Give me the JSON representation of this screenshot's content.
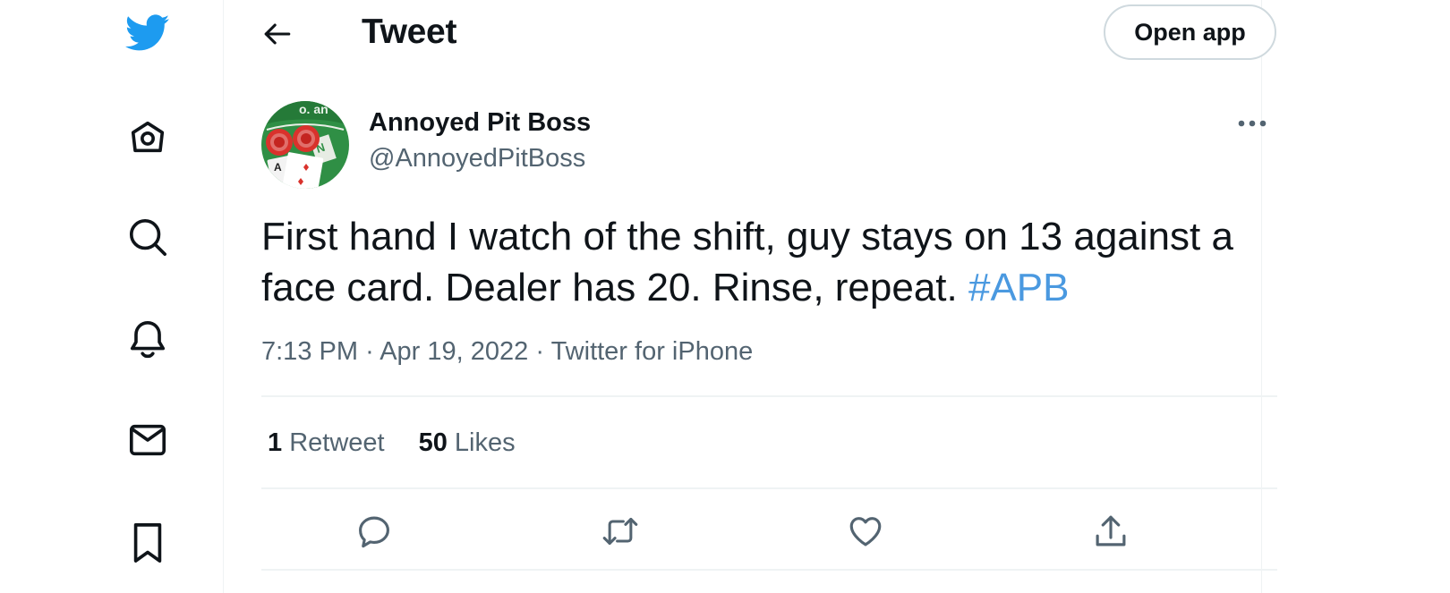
{
  "colors": {
    "brand": "#1d9bf0",
    "hashtag": "#4a99e0",
    "text_primary": "#0f1419",
    "text_secondary": "#536471",
    "divider": "#eff3f4"
  },
  "sidebar": {
    "logo_icon": "twitter-bird-icon",
    "items": [
      {
        "icon": "home-icon"
      },
      {
        "icon": "search-icon"
      },
      {
        "icon": "bell-icon"
      },
      {
        "icon": "mail-icon"
      },
      {
        "icon": "bookmark-icon"
      }
    ]
  },
  "header": {
    "back_icon": "arrow-left-icon",
    "title": "Tweet",
    "open_app_label": "Open app"
  },
  "tweet": {
    "author": {
      "name": "Annoyed Pit Boss",
      "handle": "@AnnoyedPitBoss",
      "avatar_icon": "blackjack-table-avatar"
    },
    "text_before_hashtag": "First hand I watch of the shift, guy stays on 13 against a face card. Dealer has 20. Rinse, repeat. ",
    "hashtag": "#APB",
    "time": "7:13 PM",
    "separator": "·",
    "date": "Apr 19, 2022",
    "source": "Twitter for iPhone",
    "retweets_count": "1",
    "retweets_label": "Retweet",
    "likes_count": "50",
    "likes_label": "Likes",
    "actions": [
      {
        "icon": "reply-icon"
      },
      {
        "icon": "retweet-icon"
      },
      {
        "icon": "like-icon"
      },
      {
        "icon": "share-icon"
      }
    ]
  }
}
